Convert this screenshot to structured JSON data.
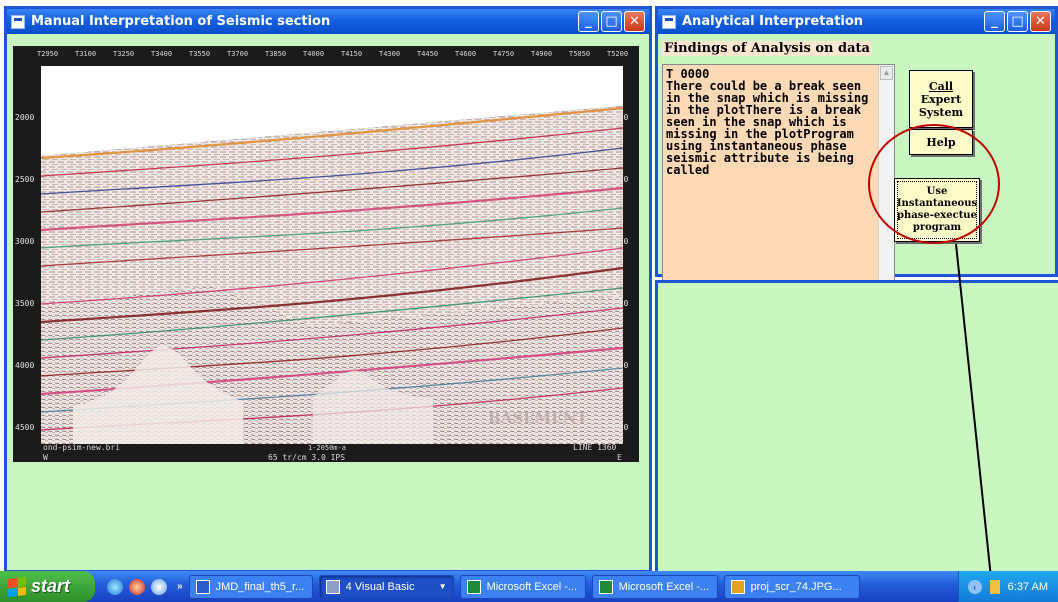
{
  "seismic_window": {
    "title": "Manual Interpretation of Seismic section",
    "section": {
      "top_ticks": [
        "T2950",
        "T3100",
        "T3250",
        "T3400",
        "T3550",
        "T3700",
        "T3850",
        "T4000",
        "T4150",
        "T4300",
        "T4450",
        "T4600",
        "T4750",
        "T4900",
        "T5050",
        "T5200"
      ],
      "depth_ticks": [
        "2000",
        "2500",
        "3000",
        "3500",
        "4000",
        "4500"
      ],
      "footer_left": "ond-psim-new.bri",
      "footer_center": "1-2050m-a",
      "footer_scale": "65 tr/cm 3.0 IPS",
      "footer_right": "LINE 1360",
      "corner_w": "W",
      "corner_e": "E",
      "basement_label": "BASEMENT"
    }
  },
  "analysis_window": {
    "title": "Analytical Interpretation",
    "findings_heading": "Findings of Analysis on data",
    "findings_text": "T 0000\nThere could be a break seen in the snap which is missing in the plotThere is a break seen in the snap which is missing in the plotProgram using instantaneous phase seismic attribute is being called",
    "buttons": {
      "call_expert_line1": "Call",
      "call_expert_line2": "Expert",
      "call_expert_line3": "System",
      "help": "Help",
      "instant_line1": "Use",
      "instant_line2": "Instantaneous",
      "instant_line3": "phase-exectue",
      "instant_line4": "program"
    }
  },
  "annotation": {
    "circle_color": "#c00000",
    "arrow_color": "#000000"
  },
  "taskbar": {
    "start": "start",
    "tasks": [
      {
        "label": "JMD_final_th5_r...",
        "icon": "word-icon"
      },
      {
        "label": "4 Visual Basic",
        "icon": "visual-basic-icon"
      },
      {
        "label": "Microsoft Excel -...",
        "icon": "excel-icon"
      },
      {
        "label": "Microsoft Excel -...",
        "icon": "excel-icon"
      },
      {
        "label": "proj_scr_74.JPG...",
        "icon": "image-viewer-icon"
      }
    ],
    "clock": "6:37 AM"
  }
}
